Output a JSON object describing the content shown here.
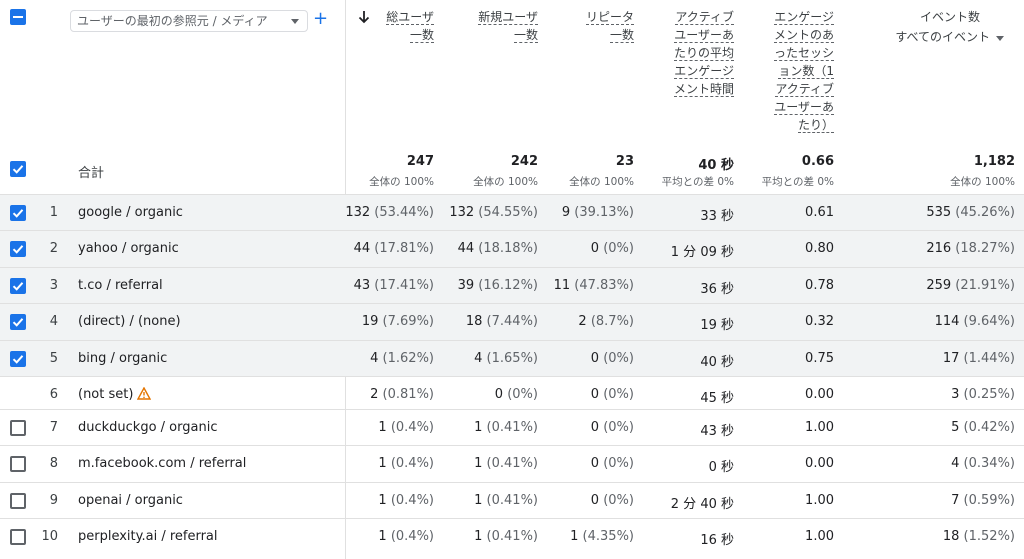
{
  "dimension_select": {
    "label": "ユーザーの最初の参照元 / メディア"
  },
  "add_dimension_label": "+",
  "columns": [
    {
      "key": "total_users",
      "label": "総ユーザ\n一数",
      "sorted": true
    },
    {
      "key": "new_users",
      "label": "新規ユーザ\n一数"
    },
    {
      "key": "returning",
      "label": "リピータ\n一数"
    },
    {
      "key": "avg_engagement",
      "label": "アクティブ\nユーザーあ\nたりの平均\nエンゲージ\nメント時間"
    },
    {
      "key": "engaged_sessions",
      "label": "エンゲージ\nメントのあ\nったセッシ\nョン数（1\nアクティブ\nユーザーあ\nたり）"
    },
    {
      "key": "events",
      "label": "イベント数",
      "sublabel": "すべてのイベント"
    }
  ],
  "totals": {
    "label": "合計",
    "values": [
      {
        "main": "247",
        "sub": "全体の 100%"
      },
      {
        "main": "242",
        "sub": "全体の 100%"
      },
      {
        "main": "23",
        "sub": "全体の 100%"
      },
      {
        "main": "40 秒",
        "sub": "平均との差 0%"
      },
      {
        "main": "0.66",
        "sub": "平均との差 0%"
      },
      {
        "main": "1,182",
        "sub": "全体の 100%"
      }
    ]
  },
  "rows": [
    {
      "rank": "1",
      "dimension": "google / organic",
      "checked": true,
      "cells": [
        [
          "132",
          "(53.44%)"
        ],
        [
          "132",
          "(54.55%)"
        ],
        [
          "9",
          "(39.13%)"
        ],
        [
          "33 秒",
          ""
        ],
        [
          "0.61",
          ""
        ],
        [
          "535",
          "(45.26%)"
        ]
      ]
    },
    {
      "rank": "2",
      "dimension": "yahoo / organic",
      "checked": true,
      "cells": [
        [
          "44",
          "(17.81%)"
        ],
        [
          "44",
          "(18.18%)"
        ],
        [
          "0",
          "(0%)"
        ],
        [
          "1 分 09 秒",
          ""
        ],
        [
          "0.80",
          ""
        ],
        [
          "216",
          "(18.27%)"
        ]
      ]
    },
    {
      "rank": "3",
      "dimension": "t.co / referral",
      "checked": true,
      "cells": [
        [
          "43",
          "(17.41%)"
        ],
        [
          "39",
          "(16.12%)"
        ],
        [
          "11",
          "(47.83%)"
        ],
        [
          "36 秒",
          ""
        ],
        [
          "0.78",
          ""
        ],
        [
          "259",
          "(21.91%)"
        ]
      ]
    },
    {
      "rank": "4",
      "dimension": "(direct) / (none)",
      "checked": true,
      "cells": [
        [
          "19",
          "(7.69%)"
        ],
        [
          "18",
          "(7.44%)"
        ],
        [
          "2",
          "(8.7%)"
        ],
        [
          "19 秒",
          ""
        ],
        [
          "0.32",
          ""
        ],
        [
          "114",
          "(9.64%)"
        ]
      ]
    },
    {
      "rank": "5",
      "dimension": "bing / organic",
      "checked": true,
      "cells": [
        [
          "4",
          "(1.62%)"
        ],
        [
          "4",
          "(1.65%)"
        ],
        [
          "0",
          "(0%)"
        ],
        [
          "40 秒",
          ""
        ],
        [
          "0.75",
          ""
        ],
        [
          "17",
          "(1.44%)"
        ]
      ]
    },
    {
      "rank": "6",
      "dimension": "(not set)",
      "checked": null,
      "warning": true,
      "cells": [
        [
          "2",
          "(0.81%)"
        ],
        [
          "0",
          "(0%)"
        ],
        [
          "0",
          "(0%)"
        ],
        [
          "45 秒",
          ""
        ],
        [
          "0.00",
          ""
        ],
        [
          "3",
          "(0.25%)"
        ]
      ]
    },
    {
      "rank": "7",
      "dimension": "duckduckgo / organic",
      "checked": false,
      "cells": [
        [
          "1",
          "(0.4%)"
        ],
        [
          "1",
          "(0.41%)"
        ],
        [
          "0",
          "(0%)"
        ],
        [
          "43 秒",
          ""
        ],
        [
          "1.00",
          ""
        ],
        [
          "5",
          "(0.42%)"
        ]
      ]
    },
    {
      "rank": "8",
      "dimension": "m.facebook.com / referral",
      "checked": false,
      "cells": [
        [
          "1",
          "(0.4%)"
        ],
        [
          "1",
          "(0.41%)"
        ],
        [
          "0",
          "(0%)"
        ],
        [
          "0 秒",
          ""
        ],
        [
          "0.00",
          ""
        ],
        [
          "4",
          "(0.34%)"
        ]
      ]
    },
    {
      "rank": "9",
      "dimension": "openai / organic",
      "checked": false,
      "cells": [
        [
          "1",
          "(0.4%)"
        ],
        [
          "1",
          "(0.41%)"
        ],
        [
          "0",
          "(0%)"
        ],
        [
          "2 分 40 秒",
          ""
        ],
        [
          "1.00",
          ""
        ],
        [
          "7",
          "(0.59%)"
        ]
      ]
    },
    {
      "rank": "10",
      "dimension": "perplexity.ai / referral",
      "checked": false,
      "cells": [
        [
          "1",
          "(0.4%)"
        ],
        [
          "1",
          "(0.41%)"
        ],
        [
          "1",
          "(4.35%)"
        ],
        [
          "16 秒",
          ""
        ],
        [
          "1.00",
          ""
        ],
        [
          "18",
          "(1.52%)"
        ]
      ]
    }
  ]
}
